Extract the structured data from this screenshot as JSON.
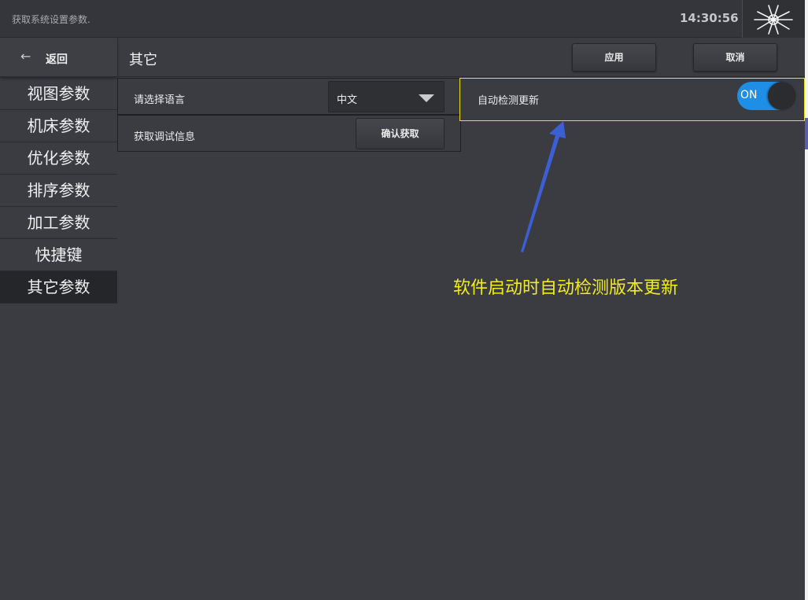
{
  "topbar": {
    "status_message": "获取系统设置参数.",
    "clock": "14:30:56",
    "logo_icon": "spider-web-logo-icon"
  },
  "sidebar": {
    "back_label": "返回",
    "back_icon": "arrow-left-icon",
    "items": [
      {
        "label": "视图参数",
        "active": false
      },
      {
        "label": "机床参数",
        "active": false
      },
      {
        "label": "优化参数",
        "active": false
      },
      {
        "label": "排序参数",
        "active": false
      },
      {
        "label": "加工参数",
        "active": false
      },
      {
        "label": "快捷键",
        "active": false
      },
      {
        "label": "其它参数",
        "active": true
      }
    ]
  },
  "header": {
    "title": "其它",
    "apply_label": "应用",
    "cancel_label": "取消"
  },
  "settings": {
    "language_label": "请选择语言",
    "language_value": "中文",
    "debug_label": "获取调试信息",
    "debug_button": "确认获取",
    "auto_update_label": "自动检测更新",
    "auto_update_state": "ON"
  },
  "annotation": {
    "text": "软件启动时自动检测版本更新"
  },
  "colors": {
    "background": "#3a3c42",
    "toggle_on": "#1f8ee6",
    "highlight_border": "#e8e01a",
    "annotation_text": "#f2ec1e",
    "arrow": "#3d5fd6"
  }
}
